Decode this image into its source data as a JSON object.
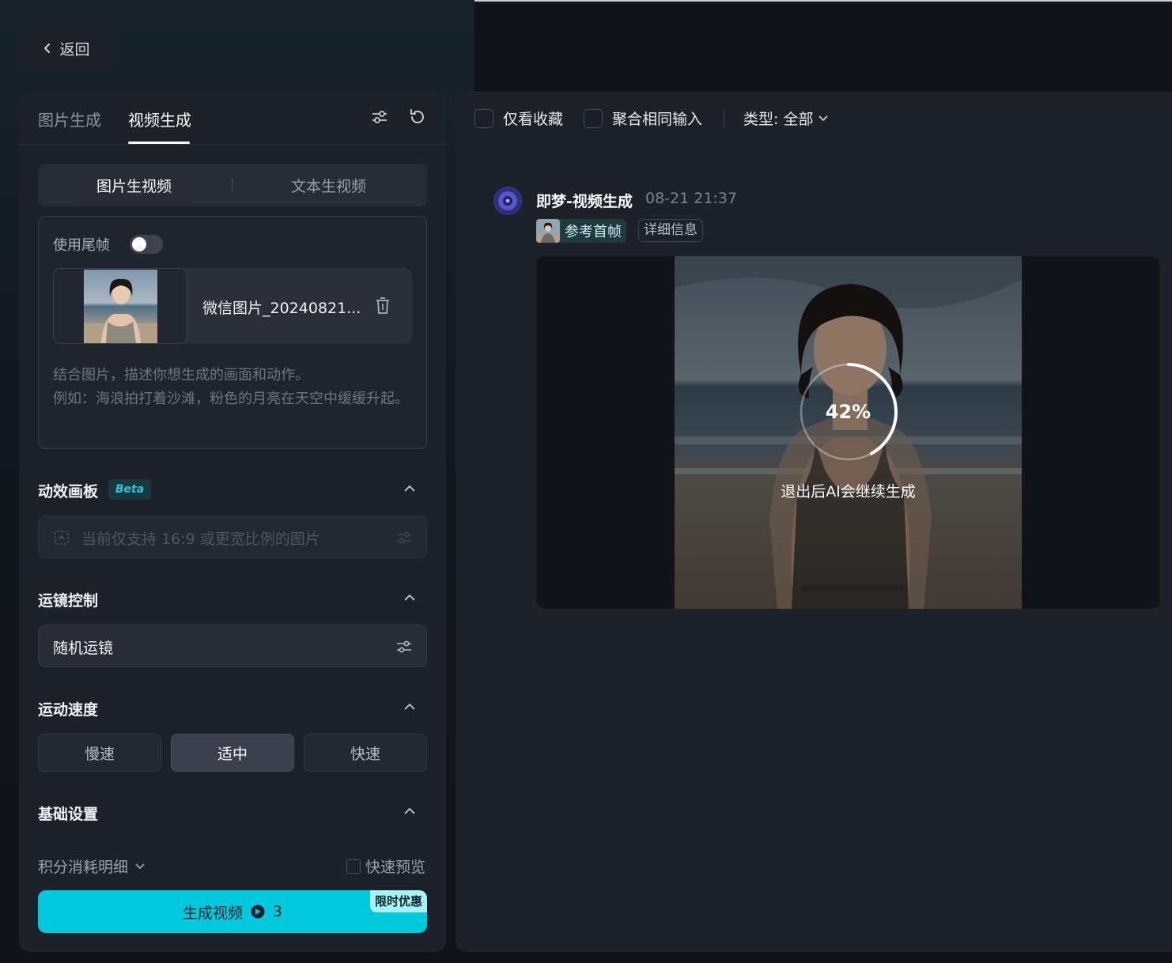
{
  "nav": {
    "back_label": "返回"
  },
  "left": {
    "tabs": [
      {
        "label": "图片生成",
        "active": false
      },
      {
        "label": "视频生成",
        "active": true
      }
    ],
    "modes": [
      {
        "label": "图片生视频",
        "active": true
      },
      {
        "label": "文本生视频",
        "active": false
      }
    ],
    "upload": {
      "use_tail_frame_label": "使用尾帧",
      "use_tail_frame_on": false,
      "file_name": "微信图片_20240821...",
      "prompt_placeholder": "结合图片，描述你想生成的画面和动作。\n例如：海浪拍打着沙滩，粉色的月亮在天空中缓缓升起。"
    },
    "effect_board": {
      "title": "动效画板",
      "badge": "Beta",
      "hint": "当前仅支持 16:9 或更宽比例的图片"
    },
    "camera": {
      "title": "运镜控制",
      "value": "随机运镜"
    },
    "motion_speed": {
      "title": "运动速度",
      "options": [
        {
          "label": "慢速",
          "active": false
        },
        {
          "label": "适中",
          "active": true
        },
        {
          "label": "快速",
          "active": false
        }
      ]
    },
    "basic_settings": {
      "title": "基础设置"
    },
    "credits_label": "积分消耗明细",
    "fast_preview_label": "快速预览",
    "generate": {
      "label": "生成视频",
      "cost": "3",
      "promo": "限时优惠"
    }
  },
  "right": {
    "filters": {
      "favorites_only": "仅看收藏",
      "merge_same_input": "聚合相同输入",
      "type_label": "类型: 全部"
    },
    "message": {
      "title": "即梦-视频生成",
      "time": "08-21  21:37",
      "ref_label": "参考首帧",
      "detail_label": "详细信息",
      "progress_percent": 42,
      "progress_text": "42%",
      "status_text": "退出后AI会继续生成"
    }
  },
  "colors": {
    "accent": "#00c8dd",
    "panel": "#1d212a",
    "background": "#111318"
  }
}
